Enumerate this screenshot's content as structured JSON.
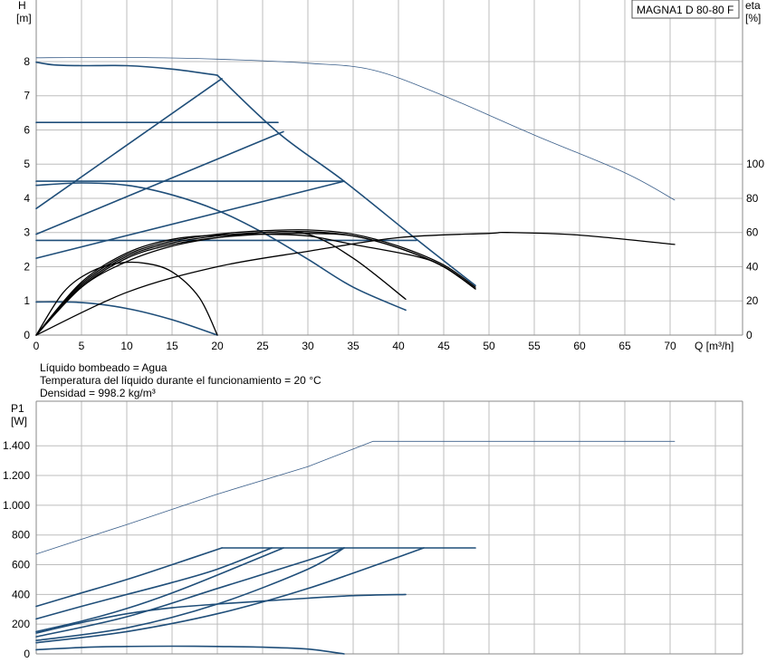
{
  "model_label": "MAGNA1 D 80-80 F",
  "fluid_info": [
    "Líquido bombeado = Agua",
    "Temperatura del líquido durante el funcionamiento = 20 °C",
    "Densidad = 998.2 kg/m³"
  ],
  "colors": {
    "curve": "#1f4e79",
    "efficiency": "#000000",
    "thin": "#3b5f8a",
    "grid": "#bdbdbd"
  },
  "chart_data": [
    {
      "type": "line",
      "panel": "head",
      "xlabel": "Q [m³/h]",
      "ylabel": "H [m]",
      "y2label": "eta [%]",
      "xlim": [
        0,
        78
      ],
      "ylim": [
        0,
        9.8
      ],
      "y2lim": [
        0,
        196
      ],
      "xticks": [
        0,
        5,
        10,
        15,
        20,
        25,
        30,
        35,
        40,
        45,
        50,
        55,
        60,
        65,
        70
      ],
      "yticks": [
        0,
        1,
        2,
        3,
        4,
        5,
        6,
        7,
        8
      ],
      "y2ticks": [
        0,
        20,
        40,
        60,
        80,
        100
      ],
      "grid": true,
      "series": [
        {
          "group": "head-max-single",
          "axis": "y",
          "x": [
            0,
            2,
            5,
            10,
            15,
            20
          ],
          "y": [
            7.98,
            7.9,
            7.88,
            7.88,
            7.78,
            7.6
          ]
        },
        {
          "group": "head-max-parallel",
          "axis": "y",
          "x": [
            20,
            26.8,
            34,
            42,
            48.5
          ],
          "y": [
            7.6,
            5.9,
            4.5,
            2.8,
            1.45
          ]
        },
        {
          "group": "const-curve",
          "axis": "y",
          "x": [
            0,
            26.7
          ],
          "y": [
            6.22,
            6.22
          ]
        },
        {
          "group": "const-curve",
          "axis": "y",
          "x": [
            0,
            34
          ],
          "y": [
            4.5,
            4.5
          ]
        },
        {
          "group": "const-curve",
          "axis": "y",
          "x": [
            0,
            42
          ],
          "y": [
            2.77,
            2.77
          ]
        },
        {
          "group": "prop-curve",
          "axis": "y",
          "x": [
            0,
            20.5
          ],
          "y": [
            3.7,
            7.5
          ]
        },
        {
          "group": "prop-curve",
          "axis": "y",
          "x": [
            0,
            27.3
          ],
          "y": [
            2.95,
            5.95
          ]
        },
        {
          "group": "prop-curve",
          "axis": "y",
          "x": [
            0,
            34
          ],
          "y": [
            2.25,
            4.5
          ]
        },
        {
          "group": "single-pump",
          "axis": "y",
          "x": [
            0,
            5,
            10,
            15,
            20,
            25,
            30,
            35,
            40.8
          ],
          "y": [
            4.38,
            4.45,
            4.38,
            4.1,
            3.65,
            3.0,
            2.22,
            1.4,
            0.73
          ]
        },
        {
          "group": "single-pump",
          "axis": "y",
          "x": [
            0,
            5,
            10,
            15,
            20
          ],
          "y": [
            0.97,
            0.95,
            0.78,
            0.45,
            0
          ]
        },
        {
          "group": "max-power",
          "axis": "y",
          "x": [
            0,
            10,
            20,
            30,
            37.2,
            45,
            55,
            65,
            70.5
          ],
          "y": [
            8.11,
            8.12,
            8.07,
            7.95,
            7.75,
            7.0,
            5.85,
            4.75,
            3.95
          ]
        },
        {
          "group": "efficiency",
          "axis": "y2",
          "x": [
            0,
            5,
            10,
            15,
            20,
            25,
            30,
            35,
            40.8
          ],
          "y": [
            0,
            28,
            43,
            52,
            57,
            60,
            59,
            45,
            21
          ]
        },
        {
          "group": "efficiency",
          "axis": "y2",
          "x": [
            0,
            3,
            6,
            9,
            12,
            15,
            18,
            20
          ],
          "y": [
            0,
            25,
            37,
            42,
            42,
            37,
            22,
            0
          ]
        },
        {
          "group": "efficiency",
          "axis": "y2",
          "x": [
            0,
            5,
            10,
            15,
            20,
            25,
            30,
            35,
            40,
            45,
            48.5
          ],
          "y": [
            0,
            28,
            45,
            53,
            57,
            59,
            59.5,
            58,
            51,
            40,
            27
          ]
        },
        {
          "group": "efficiency",
          "axis": "y2",
          "x": [
            0,
            5,
            10,
            15,
            20,
            25,
            30,
            35,
            40,
            45,
            48.5
          ],
          "y": [
            0,
            29,
            46,
            54,
            58,
            60,
            60.5,
            58,
            51,
            40,
            27
          ]
        },
        {
          "group": "efficiency",
          "axis": "y2",
          "x": [
            0,
            5,
            10,
            15,
            20,
            25,
            30,
            35,
            40,
            45,
            48.5
          ],
          "y": [
            0,
            30,
            47,
            55,
            59,
            61,
            61.5,
            59,
            52,
            41,
            28
          ]
        },
        {
          "group": "efficiency",
          "axis": "y2",
          "x": [
            0,
            5,
            10,
            15,
            20,
            25,
            30,
            35,
            42,
            45,
            48.5
          ],
          "y": [
            0,
            31,
            48,
            56,
            58.5,
            59,
            58,
            53,
            46,
            40,
            27
          ]
        },
        {
          "group": "efficiency",
          "axis": "y2",
          "x": [
            0,
            10,
            20,
            30,
            40,
            50,
            52,
            60,
            70.5
          ],
          "y": [
            0,
            25,
            40,
            49,
            57,
            59.5,
            60,
            58.5,
            53
          ]
        }
      ]
    },
    {
      "type": "line",
      "panel": "power",
      "xlabel": "",
      "ylabel": "P1 [W]",
      "xlim": [
        0,
        78
      ],
      "ylim": [
        0,
        1700
      ],
      "yticks": [
        0,
        200,
        400,
        600,
        800,
        1000,
        1200,
        1400
      ],
      "ytick_labels": [
        "0",
        "200",
        "400",
        "600",
        "800",
        "1.000",
        "1.200",
        "1.400"
      ],
      "grid": true,
      "series": [
        {
          "group": "max-power",
          "x": [
            0,
            10,
            20,
            30,
            37.2,
            45,
            55,
            70.5
          ],
          "y": [
            672,
            870,
            1075,
            1260,
            1430,
            1430,
            1430,
            1430
          ]
        },
        {
          "group": "max",
          "x": [
            20.5,
            48.5
          ],
          "y": [
            713,
            713
          ]
        },
        {
          "group": "curve",
          "x": [
            0,
            5,
            10,
            15,
            20.5
          ],
          "y": [
            320,
            410,
            500,
            600,
            713
          ]
        },
        {
          "group": "curve",
          "x": [
            0,
            5,
            10,
            15,
            20,
            26
          ],
          "y": [
            235,
            320,
            400,
            480,
            570,
            713
          ]
        },
        {
          "group": "curve",
          "x": [
            0,
            5,
            10,
            15,
            20,
            27.3
          ],
          "y": [
            150,
            220,
            305,
            410,
            530,
            713
          ]
        },
        {
          "group": "curve",
          "x": [
            0,
            10,
            20,
            30,
            34
          ],
          "y": [
            115,
            250,
            440,
            630,
            713
          ]
        },
        {
          "group": "curve",
          "x": [
            0,
            10,
            20,
            30,
            34
          ],
          "y": [
            90,
            175,
            335,
            570,
            713
          ]
        },
        {
          "group": "curve",
          "x": [
            0,
            10,
            20,
            30,
            42.8
          ],
          "y": [
            75,
            150,
            270,
            440,
            713
          ]
        },
        {
          "group": "curve",
          "x": [
            0,
            5,
            10,
            15,
            20,
            25,
            30,
            35,
            40.8
          ],
          "y": [
            140,
            210,
            270,
            310,
            335,
            355,
            375,
            392,
            400
          ]
        },
        {
          "group": "curve",
          "x": [
            0,
            5,
            10,
            15,
            20,
            25,
            30,
            34
          ],
          "y": [
            28,
            43,
            50,
            52,
            50,
            45,
            32,
            0
          ]
        }
      ]
    }
  ]
}
